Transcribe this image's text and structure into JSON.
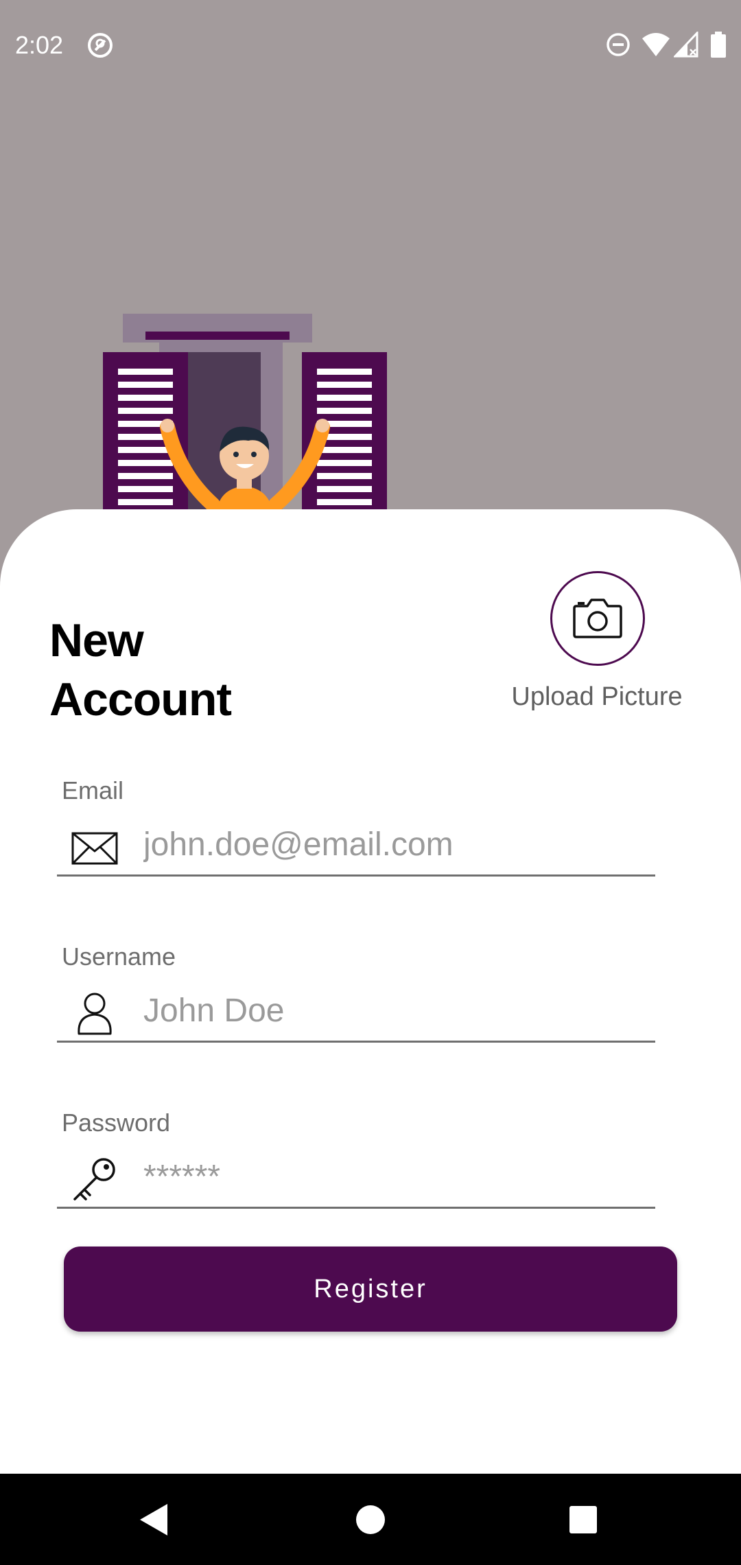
{
  "status_bar": {
    "time": "2:02",
    "icons": [
      "vpn-key-icon",
      "do-not-disturb-icon",
      "wifi-icon",
      "cell-signal-icon",
      "battery-icon"
    ]
  },
  "illustration": {
    "icon": "person-at-window-illustration",
    "colors": {
      "shutter": "#4d0a4f",
      "frame": "#8f7f93",
      "shirt": "#ff9a1f"
    }
  },
  "form": {
    "title_line1": "New",
    "title_line2": "Account",
    "upload": {
      "label": "Upload Picture",
      "icon": "camera-icon"
    },
    "email": {
      "label": "Email",
      "placeholder": "john.doe@email.com",
      "value": "",
      "icon": "envelope-icon"
    },
    "username": {
      "label": "Username",
      "placeholder": "John Doe",
      "value": "",
      "icon": "person-icon"
    },
    "password": {
      "label": "Password",
      "placeholder": "******",
      "value": "",
      "icon": "key-icon"
    },
    "register_label": "Register"
  },
  "theme": {
    "accent": "#4d0a4f",
    "background": "#a39b9c",
    "sheet": "#ffffff"
  },
  "nav_bar": {
    "buttons": [
      "back-icon",
      "home-icon",
      "recents-icon"
    ]
  }
}
